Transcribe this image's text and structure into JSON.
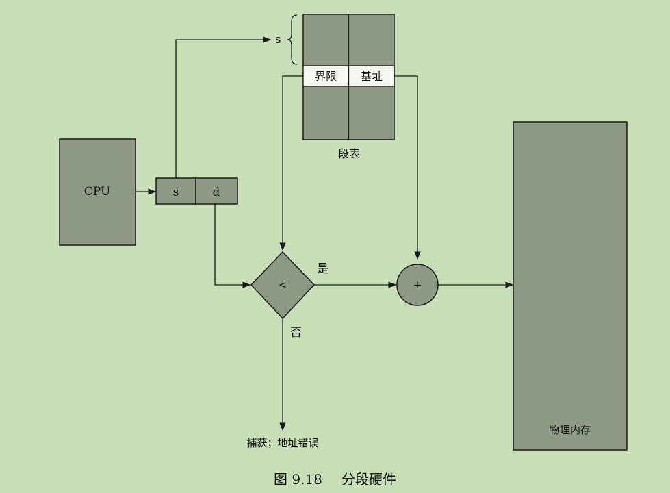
{
  "diagram": {
    "cpu_label": "CPU",
    "address_s": "s",
    "address_d": "d",
    "segment_pointer_s": "s",
    "limit_label": "界限",
    "base_label": "基址",
    "segment_table_label": "段表",
    "compare_symbol": "<",
    "yes_label": "是",
    "no_label": "否",
    "adder_symbol": "+",
    "trap_label": "捕获；地址错误",
    "physical_memory_label": "物理内存"
  },
  "caption": {
    "figure_number": "图 9.18",
    "title": "分段硬件"
  },
  "colors": {
    "background": "#c9dfb8",
    "box_fill": "#8e9a85",
    "stroke": "#1a1a1a",
    "cell_white": "#f7f7f2"
  }
}
